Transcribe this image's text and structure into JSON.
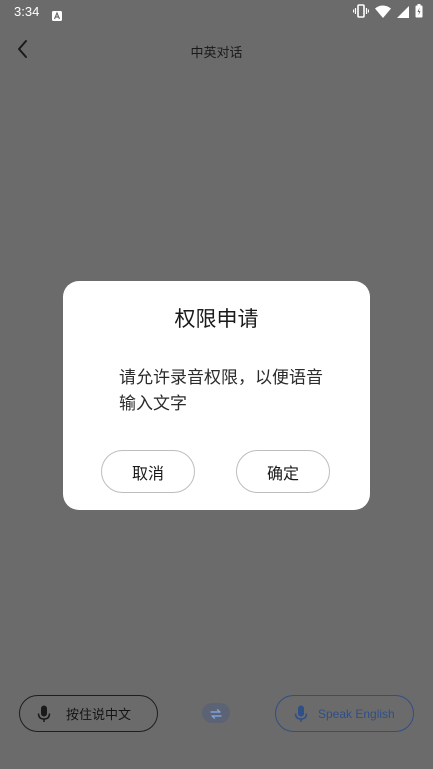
{
  "status_bar": {
    "time": "3:34",
    "icons": [
      "notification-a-icon",
      "vibrate-icon",
      "wifi-icon",
      "signal-icon",
      "battery-icon"
    ]
  },
  "header": {
    "back_icon": "chevron-left-icon",
    "title": "中英对话"
  },
  "dialog": {
    "title": "权限申请",
    "message": "请允许录音权限，以便语音输入文字",
    "cancel_label": "取消",
    "confirm_label": "确定"
  },
  "bottom_bar": {
    "chinese_button_label": "按住说中文",
    "english_button_label": "Speak English",
    "swap_icon": "swap-arrows-icon"
  },
  "colors": {
    "background_dimmed": "#6b6b6b",
    "dialog_bg": "#ffffff",
    "english_accent": "#2f4f86"
  }
}
